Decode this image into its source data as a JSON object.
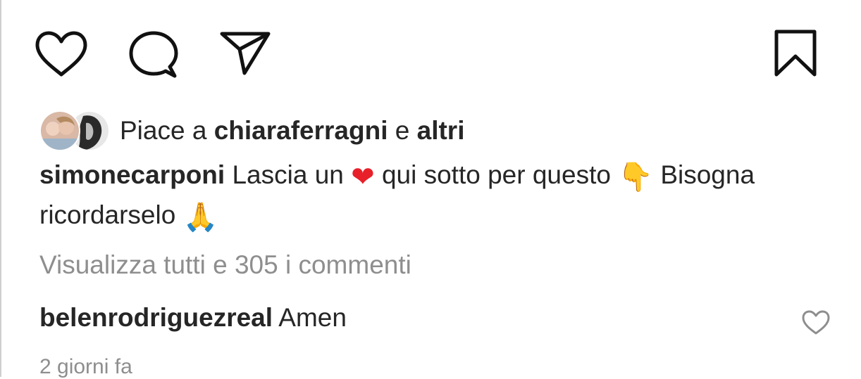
{
  "post": {
    "actions": {
      "like_icon": "heart-outline-icon",
      "comment_icon": "comment-bubble-icon",
      "share_icon": "paper-plane-icon",
      "save_icon": "bookmark-outline-icon"
    },
    "likes": {
      "prefix": "Piace a",
      "liker": "chiaraferragni",
      "conjunction": "e",
      "others": "altri"
    },
    "caption": {
      "author": "simonecarponi",
      "text_part1": "Lascia un",
      "emoji_heart": "❤",
      "text_part2": "qui sotto per questo",
      "emoji_point_down": "👇",
      "text_part3": "Bisogna ricordarselo",
      "emoji_pray": "🙏"
    },
    "view_all_comments": "Visualizza tutti e 305 i commenti",
    "comments": [
      {
        "author": "belenrodriguezreal",
        "text": "Amen",
        "like_icon": "heart-outline-icon"
      }
    ],
    "timestamp": "2 giorni fa"
  },
  "colors": {
    "text": "#262626",
    "muted": "#8e8e8e",
    "heart_emoji": "#e8202a"
  }
}
